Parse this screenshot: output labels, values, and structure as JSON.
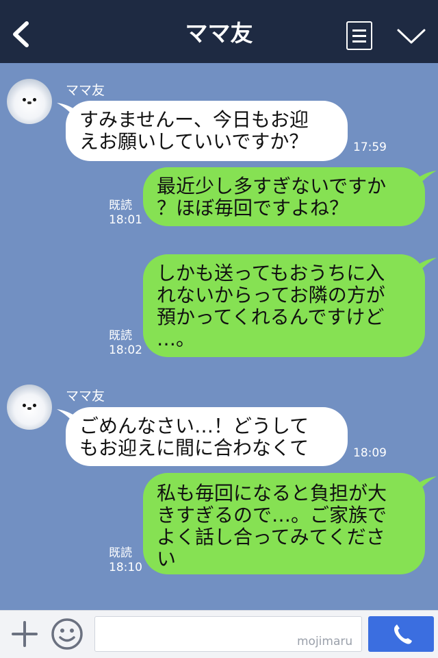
{
  "header": {
    "title": "ママ友"
  },
  "messages": [
    {
      "sender": "ママ友",
      "text": "すみませんー、今日もお迎\nえお願いしていいですか？",
      "time": "17:59"
    },
    {
      "read": "既読",
      "time": "18:01",
      "text": "最近少し多すぎないですか\n？ほぼ毎回ですよね？"
    },
    {
      "read": "既読",
      "time": "18:02",
      "text": "しかも送ってもおうちに入\nれないからってお隣の方が\n預かってくれるんですけど\n…。"
    },
    {
      "sender": "ママ友",
      "text": "ごめんなさい…！どうして\nもお迎えに間に合わなくて",
      "time": "18:09"
    },
    {
      "read": "既読",
      "time": "18:10",
      "text": "私も毎回になると負担が大\nきすぎるので…。ご家族で\nよく話し合ってみてくださ\nい"
    }
  ],
  "footer": {
    "input_value": "",
    "watermark": "mojimaru"
  },
  "colors": {
    "background": "#7290c2",
    "header": "#1e2a42",
    "incoming_bubble": "#ffffff",
    "outgoing_bubble": "#86e153",
    "call_button": "#3b6ee0"
  },
  "icons": {
    "back": "back-chevron-icon",
    "menu": "menu-document-icon",
    "collapse": "chevron-down-icon",
    "plus": "plus-icon",
    "emoji": "emoji-smiley-icon",
    "call": "phone-icon"
  }
}
